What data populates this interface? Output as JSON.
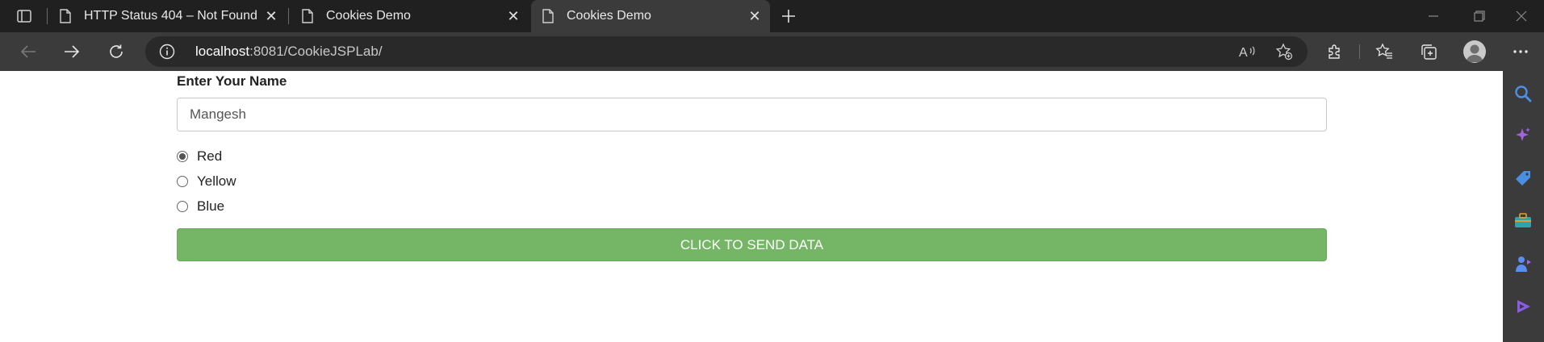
{
  "browser": {
    "tabs": [
      {
        "title": "HTTP Status 404 – Not Found",
        "active": false
      },
      {
        "title": "Cookies Demo",
        "active": false
      },
      {
        "title": "Cookies Demo",
        "active": true
      }
    ],
    "close_glyph": "✕",
    "address": {
      "host": "localhost",
      "rest": ":8081/CookieJSPLab/"
    },
    "icons": {
      "tab_actions": "tab-actions-icon",
      "new_tab": "plus-icon",
      "minimize": "minimize-icon",
      "restore": "restore-icon",
      "close_window": "close-icon",
      "back": "back-arrow-icon",
      "forward": "forward-arrow-icon",
      "refresh": "refresh-icon",
      "site_info": "info-icon",
      "read_aloud": "read-aloud-icon",
      "add_favorite": "add-favorite-icon",
      "extensions": "puzzle-icon",
      "favorites": "favorites-icon",
      "collections": "collections-icon",
      "profile": "avatar",
      "more": "more-icon"
    },
    "sidebar_icons": [
      "search-icon",
      "copilot-icon",
      "shopping-tag-icon",
      "tools-briefcase-icon",
      "games-icon",
      "media-play-icon"
    ],
    "colors": {
      "frame": "#202020",
      "toolbar": "#3b3b3b",
      "omnibox": "#292929",
      "accent_blue": "#4f8fe8"
    }
  },
  "form": {
    "name_label": "Enter Your Name",
    "name_value": "Mangesh",
    "colors": [
      {
        "label": "Red",
        "checked": true
      },
      {
        "label": "Yellow",
        "checked": false
      },
      {
        "label": "Blue",
        "checked": false
      }
    ],
    "submit_label": "CLICK TO SEND DATA",
    "submit_color": "#74b566"
  }
}
